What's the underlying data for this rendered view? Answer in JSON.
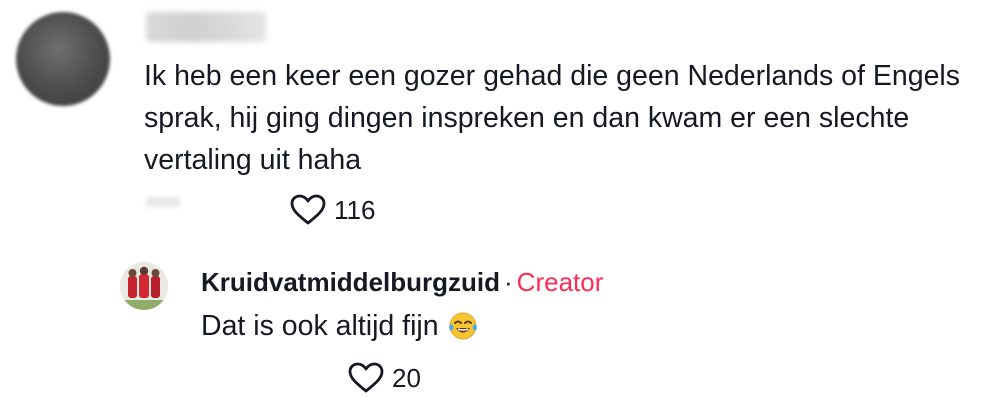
{
  "main_comment": {
    "username": "",
    "text": "Ik heb een keer een gozer gehad die geen Nederlands of Engels sprak, hij ging dingen inspreken en dan kwam er een slechte vertaling uit haha",
    "date": "",
    "like_count": "116",
    "like_icon": "heart-outline-icon"
  },
  "reply": {
    "username": "Kruidvatmiddelburgzuid",
    "separator": "·",
    "badge": "Creator",
    "badge_color": "#fe2c55",
    "text": "Dat is ook altijd fijn",
    "emoji": "face-with-tears-of-joy-icon",
    "like_count": "20",
    "like_icon": "heart-outline-icon"
  }
}
